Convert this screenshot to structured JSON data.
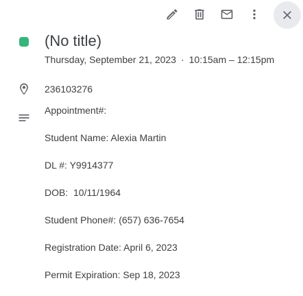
{
  "event": {
    "title": "(No title)",
    "date": "Thursday, September 21, 2023",
    "separator": "·",
    "time": "10:15am – 12:15pm",
    "color": "#33b679",
    "location": "236103276",
    "description": [
      "Appointment#:",
      "Student Name: Alexia Martin",
      "DL #: Y9914377",
      "DOB:  10/11/1964",
      "Student Phone#: (657) 636-7654",
      "Registration Date: April 6, 2023",
      "Permit Expiration: Sep 18, 2023"
    ]
  },
  "toolbar": {
    "icons": [
      "edit-icon",
      "delete-icon",
      "email-icon",
      "more-options-icon",
      "close-icon"
    ]
  }
}
